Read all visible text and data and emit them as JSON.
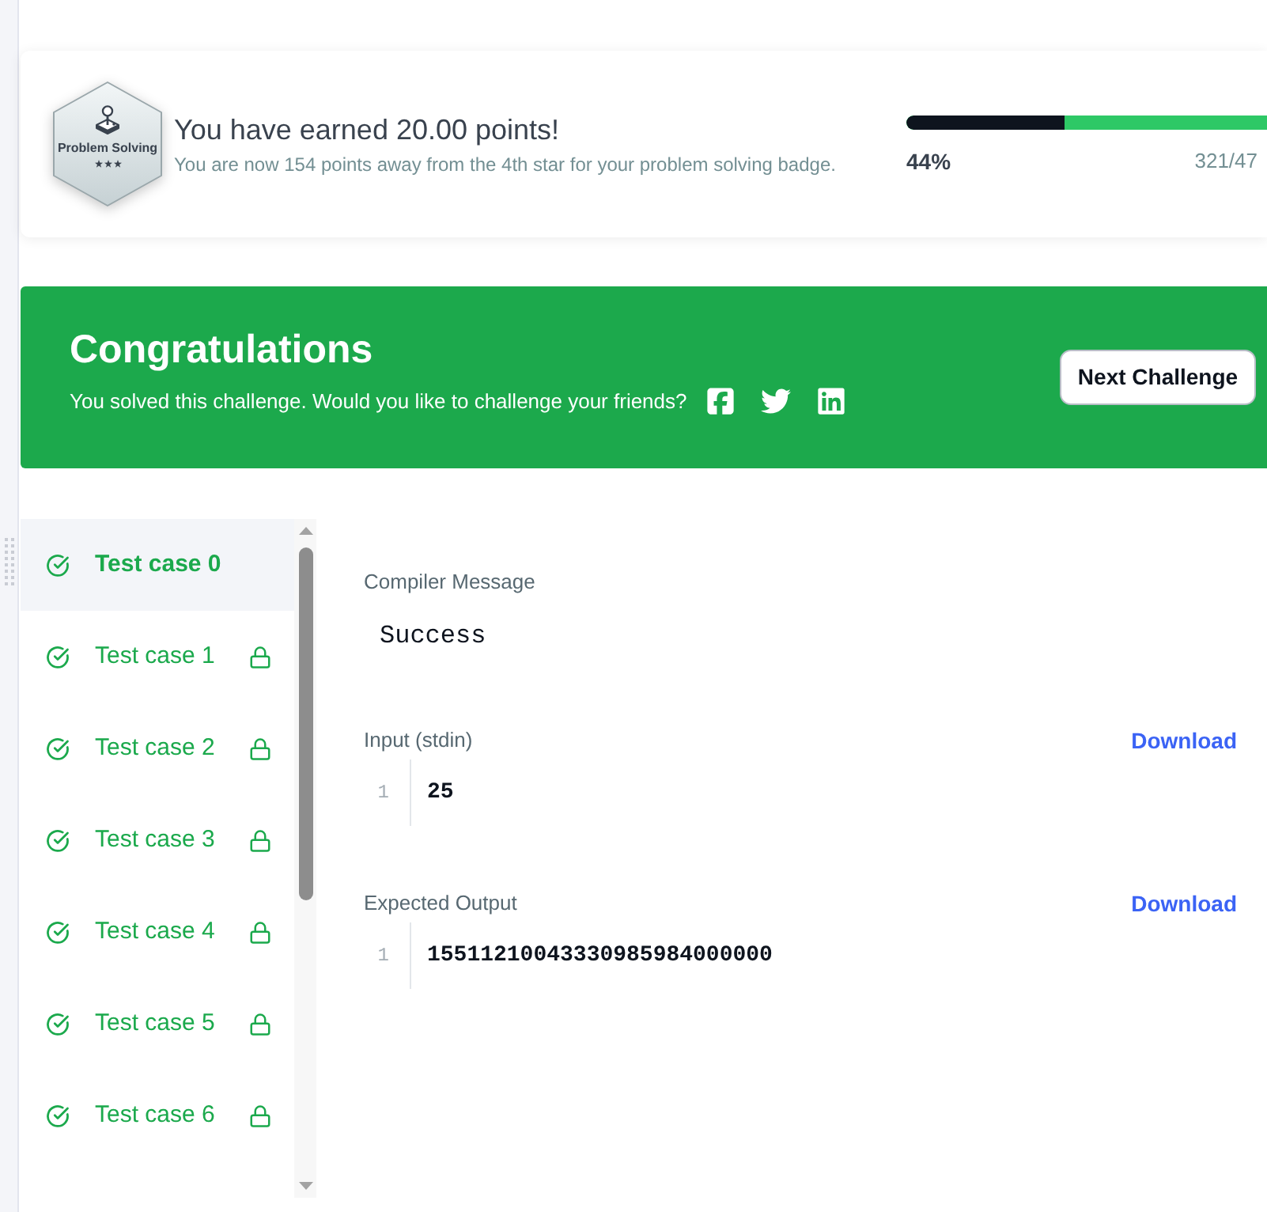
{
  "badge_card": {
    "badge": {
      "label": "Problem Solving",
      "stars": 3
    },
    "title": "You have earned 20.00 points!",
    "subtitle": "You are now 154 points away from the 4th star for your problem solving badge.",
    "progress": {
      "level": 0.44,
      "percent": "44%",
      "points": "321/47"
    }
  },
  "banner": {
    "title": "Congratulations",
    "message": "You solved this challenge. Would you like to challenge your friends?",
    "button": "Next Challenge"
  },
  "test_cases": [
    {
      "label": "Test case 0",
      "passed": true,
      "locked": false,
      "selected": true
    },
    {
      "label": "Test case 1",
      "passed": true,
      "locked": true,
      "selected": false
    },
    {
      "label": "Test case 2",
      "passed": true,
      "locked": true,
      "selected": false
    },
    {
      "label": "Test case 3",
      "passed": true,
      "locked": true,
      "selected": false
    },
    {
      "label": "Test case 4",
      "passed": true,
      "locked": true,
      "selected": false
    },
    {
      "label": "Test case 5",
      "passed": true,
      "locked": true,
      "selected": false
    },
    {
      "label": "Test case 6",
      "passed": true,
      "locked": true,
      "selected": false
    }
  ],
  "result": [
    {
      "kind": "message",
      "label": "Compiler Message",
      "text": "Success"
    },
    {
      "kind": "code",
      "label": "Input (stdin)",
      "action": "Download",
      "lines": [
        {
          "number": "1",
          "text": "25"
        }
      ]
    },
    {
      "kind": "code",
      "label": "Expected Output",
      "action": "Download",
      "lines": [
        {
          "number": "1",
          "text": "15511210043330985984000000"
        }
      ]
    }
  ]
}
